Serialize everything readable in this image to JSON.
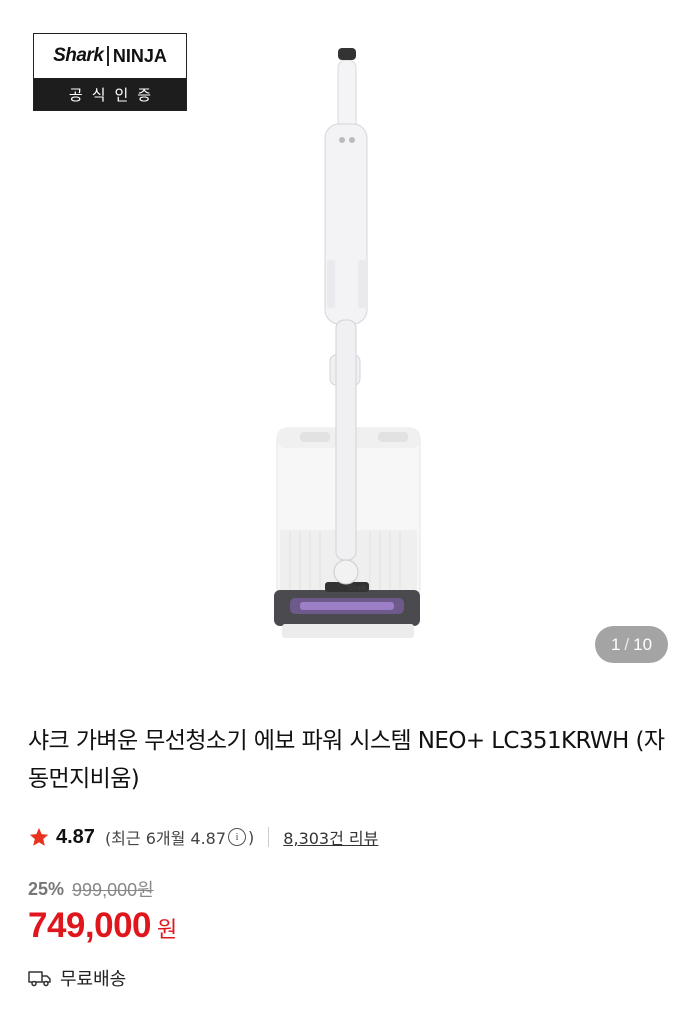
{
  "badge": {
    "brand": "Shark",
    "brand2": "NINJA",
    "label": "공식인증"
  },
  "pager": {
    "current": "1",
    "total": "10"
  },
  "product": {
    "title": "샤크 가벼운 무선청소기 에보 파워 시스템 NEO+ LC351KRWH (자동먼지비움)",
    "rating": "4.87",
    "recent_prefix": "(최근 6개월 4.87",
    "recent_suffix": ")",
    "reviews": "8,303건 리뷰",
    "discount": "25%",
    "original_price": "999,000원",
    "price": "749,000",
    "currency": "원",
    "shipping": "무료배송"
  },
  "colors": {
    "accent": "#e0161d",
    "star": "#e8311f"
  },
  "icons": {
    "star": "star-icon",
    "info": "info-icon",
    "truck": "truck-icon"
  }
}
